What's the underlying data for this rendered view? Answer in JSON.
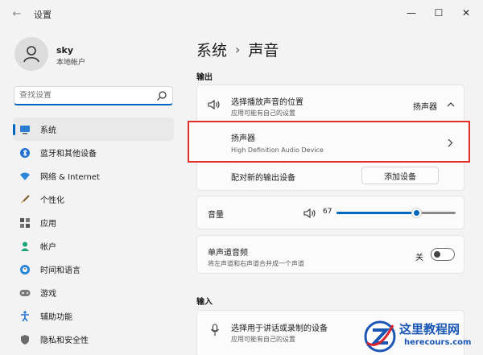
{
  "window": {
    "title": "设置",
    "back": "←",
    "min": "—",
    "max": "☐",
    "close": "✕"
  },
  "user": {
    "name": "sky",
    "type": "本地帐户"
  },
  "search": {
    "placeholder": "查找设置"
  },
  "nav": [
    {
      "label": "系统",
      "icon": "display-icon",
      "active": true
    },
    {
      "label": "蓝牙和其他设备",
      "icon": "bluetooth-icon"
    },
    {
      "label": "网络 & Internet",
      "icon": "wifi-icon"
    },
    {
      "label": "个性化",
      "icon": "brush-icon"
    },
    {
      "label": "应用",
      "icon": "apps-icon"
    },
    {
      "label": "帐户",
      "icon": "account-icon"
    },
    {
      "label": "时间和语言",
      "icon": "globe-clock-icon"
    },
    {
      "label": "游戏",
      "icon": "gamepad-icon"
    },
    {
      "label": "辅助功能",
      "icon": "accessibility-icon"
    },
    {
      "label": "隐私和安全性",
      "icon": "shield-icon"
    }
  ],
  "breadcrumb": {
    "parent": "系统",
    "sep": "›",
    "current": "声音"
  },
  "output": {
    "heading": "输出",
    "choose_title": "选择播放声音的位置",
    "choose_sub": "应用可能有自己的设置",
    "choose_value": "扬声器",
    "device_title": "扬声器",
    "device_sub": "High Definition Audio Device",
    "pair_label": "配对新的输出设备",
    "add_button": "添加设备"
  },
  "volume": {
    "label": "音量",
    "value": "67",
    "level": 0.67
  },
  "mono": {
    "title": "单声道音频",
    "sub": "将左声道和右声道合并成一个声道",
    "state": "关"
  },
  "input": {
    "heading": "输入",
    "choose_title": "选择用于讲话或录制的设备",
    "choose_sub": "应用可能有自己的设置"
  },
  "watermark": {
    "text": "这里教程网",
    "url": "herecours.com"
  },
  "colors": {
    "accent": "#0067c0",
    "highlight": "#e0302b"
  }
}
